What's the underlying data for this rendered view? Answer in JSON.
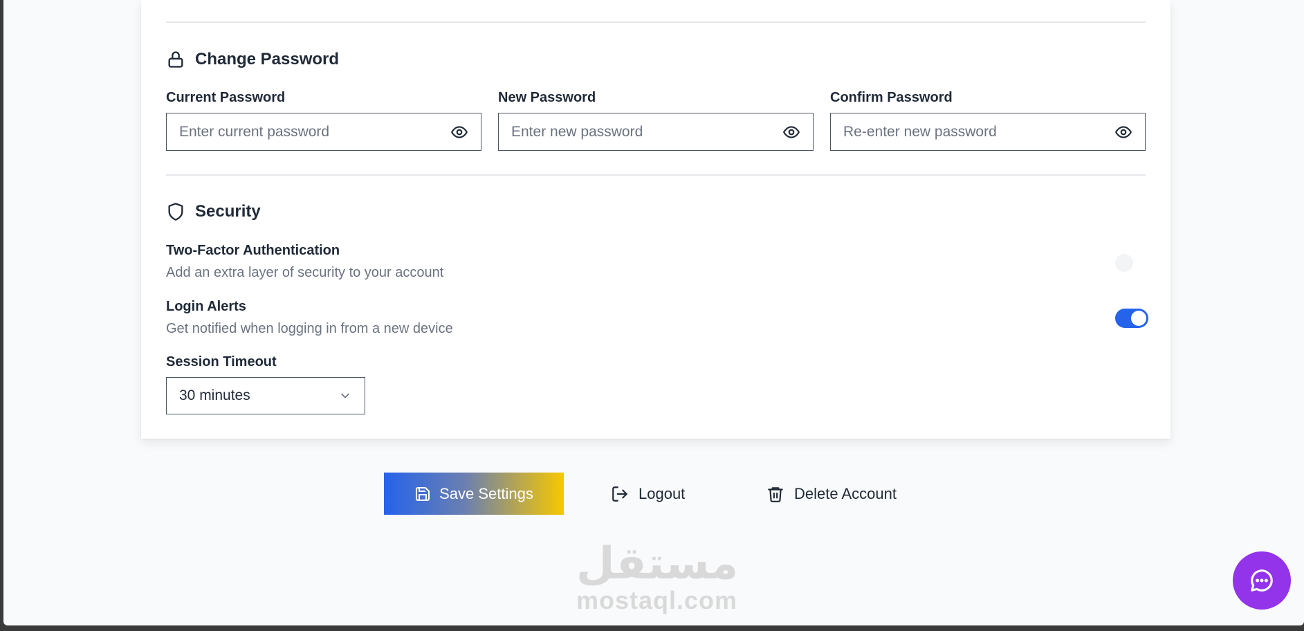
{
  "change_password": {
    "title": "Change Password",
    "current": {
      "label": "Current Password",
      "placeholder": "Enter current password"
    },
    "new": {
      "label": "New Password",
      "placeholder": "Enter new password"
    },
    "confirm": {
      "label": "Confirm Password",
      "placeholder": "Re-enter new password"
    }
  },
  "security": {
    "title": "Security",
    "two_factor": {
      "title": "Two-Factor Authentication",
      "description": "Add an extra layer of security to your account",
      "enabled": false
    },
    "login_alerts": {
      "title": "Login Alerts",
      "description": "Get notified when logging in from a new device",
      "enabled": true
    },
    "session_timeout": {
      "label": "Session Timeout",
      "value": "30 minutes"
    }
  },
  "actions": {
    "save": "Save Settings",
    "logout": "Logout",
    "delete": "Delete Account"
  },
  "watermark": {
    "arabic": "مستقل",
    "latin": "mostaql.com"
  },
  "colors": {
    "accent": "#2563eb",
    "gradient_end": "#f7c800",
    "fab": "#9333ea"
  }
}
